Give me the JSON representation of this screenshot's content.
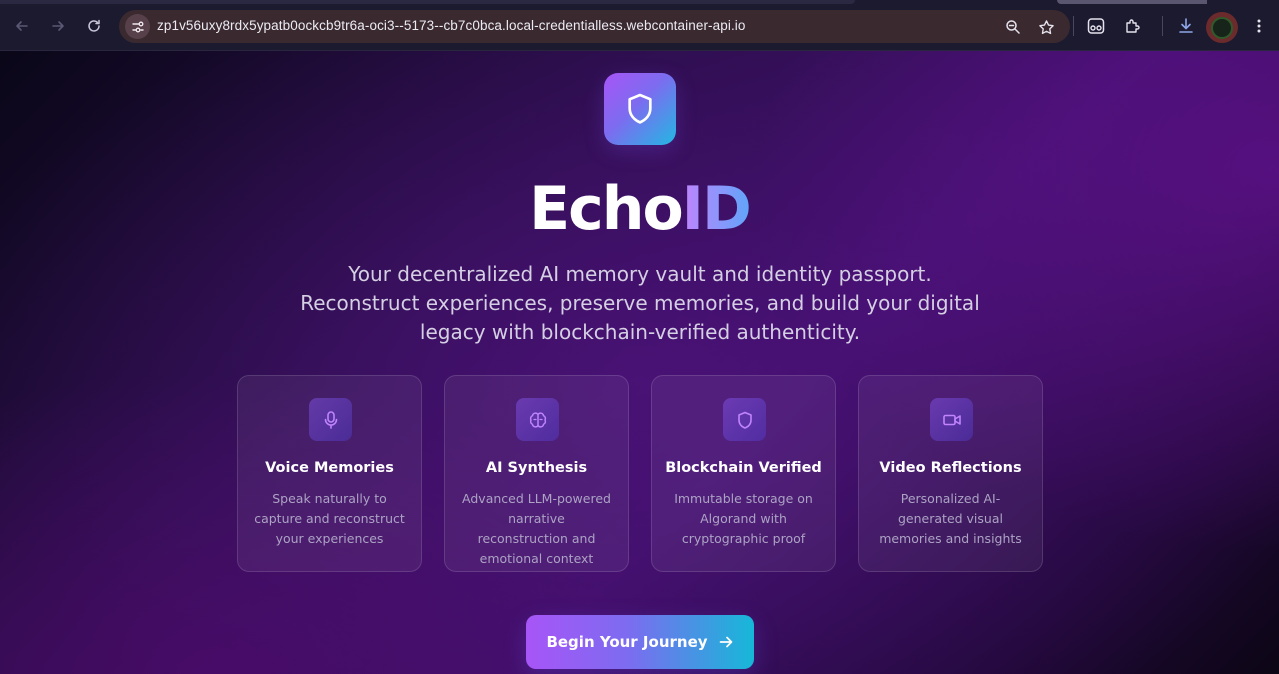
{
  "browser": {
    "url": "zp1v56uxy8rdx5ypatb0ockcb9tr6a-oci3--5173--cb7c0bca.local-credentialless.webcontainer-api.io",
    "icons": [
      "back-icon",
      "forward-icon",
      "reload-icon",
      "site-info-icon",
      "zoom-icon",
      "bookmark-star-icon",
      "incognito-extension-icon",
      "extensions-puzzle-icon",
      "download-icon",
      "profile-avatar",
      "menu-kebab-icon"
    ]
  },
  "hero": {
    "logo_icon": "shield-icon",
    "title_main": "Echo",
    "title_accent": "ID",
    "subtitle": "Your decentralized AI memory vault and identity passport. Reconstruct experiences, preserve memories, and build your digital legacy with blockchain-verified authenticity."
  },
  "features": [
    {
      "icon": "microphone-icon",
      "title": "Voice Memories",
      "description": "Speak naturally to capture and reconstruct your experiences"
    },
    {
      "icon": "brain-icon",
      "title": "AI Synthesis",
      "description": "Advanced LLM-powered narrative reconstruction and emotional context"
    },
    {
      "icon": "shield-icon",
      "title": "Blockchain Verified",
      "description": "Immutable storage on Algorand with cryptographic proof"
    },
    {
      "icon": "video-camera-icon",
      "title": "Video Reflections",
      "description": "Personalized AI-generated visual memories and insights"
    }
  ],
  "cta": {
    "label": "Begin Your Journey",
    "icon": "arrow-right-icon"
  },
  "colors": {
    "accent_purple": "#a855f7",
    "accent_cyan": "#16b8d8",
    "icon_purple": "#c084fc",
    "background_dark": "#0a0718"
  }
}
